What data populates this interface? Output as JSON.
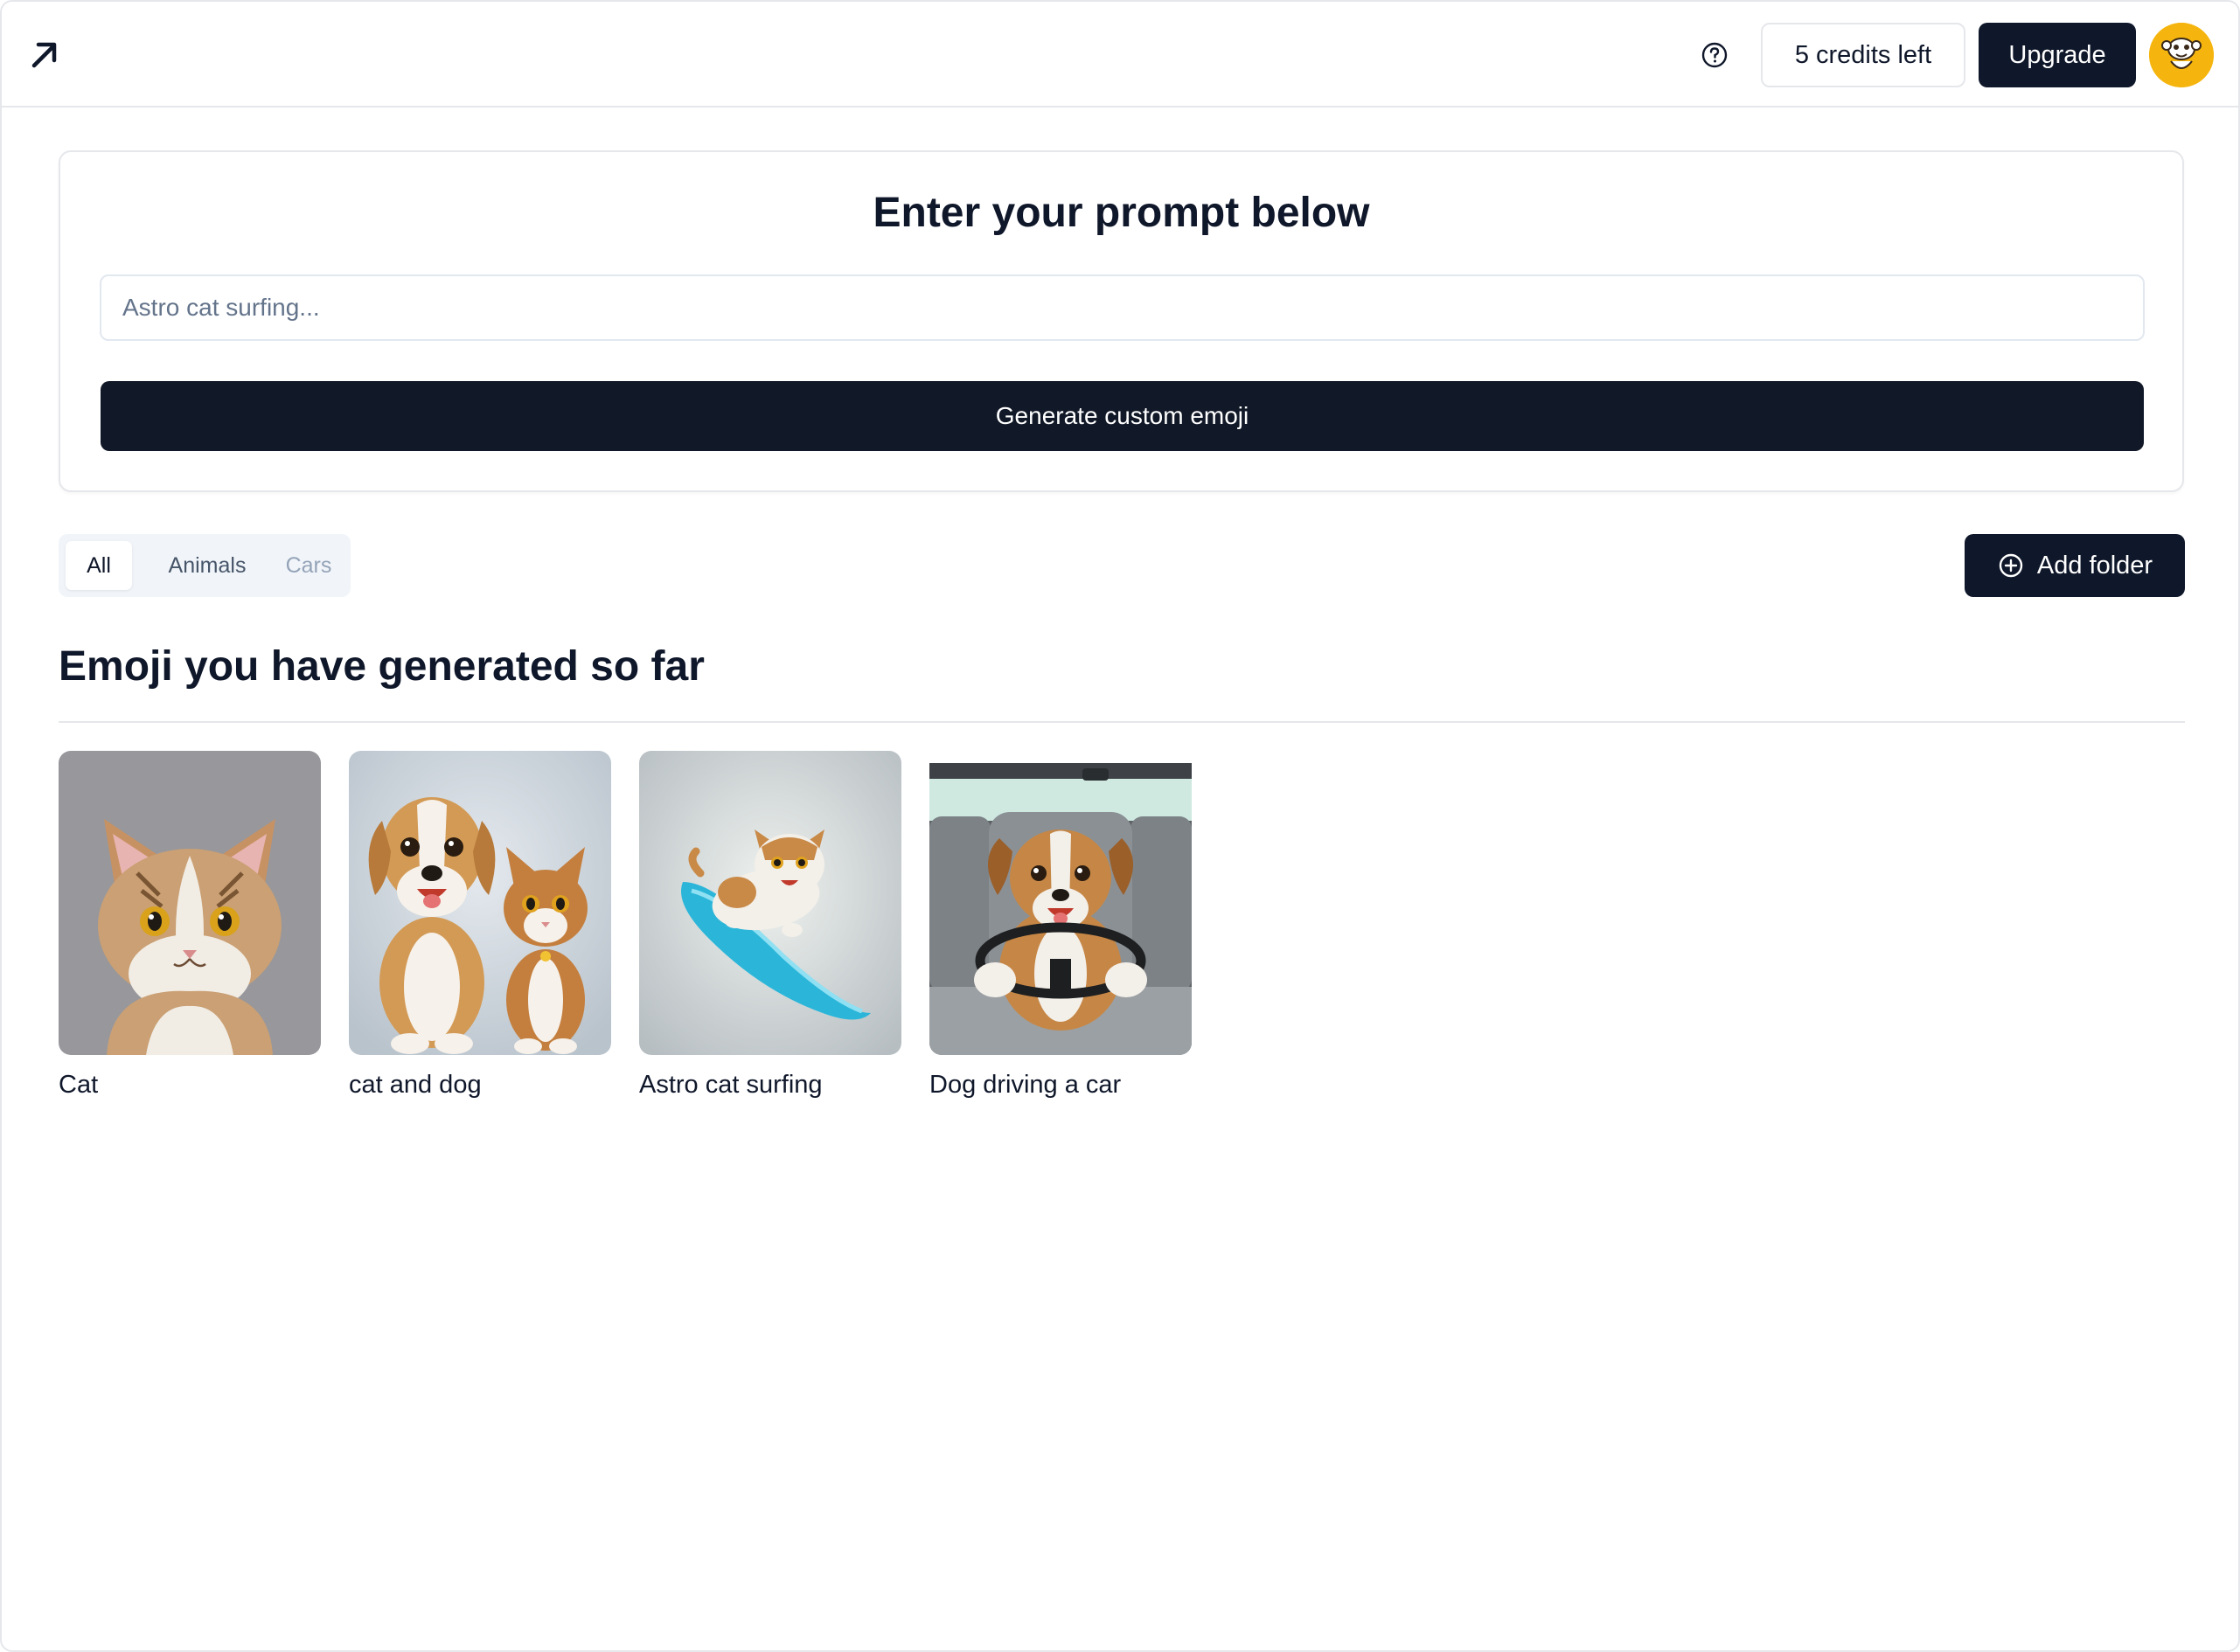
{
  "header": {
    "credits_label": "5 credits left",
    "upgrade_label": "Upgrade",
    "logo_icon": "arrow-up-right-icon",
    "help_icon": "help-circle-icon",
    "avatar_icon": "monkey-avatar-icon"
  },
  "prompt": {
    "title": "Enter your prompt below",
    "placeholder": "Astro cat surfing...",
    "value": "",
    "generate_label": "Generate custom emoji"
  },
  "tabs": [
    {
      "label": "All",
      "active": true
    },
    {
      "label": "Animals",
      "active": false
    },
    {
      "label": "Cars",
      "active": false
    }
  ],
  "add_folder_label": "Add folder",
  "gallery": {
    "title": "Emoji you have generated so far",
    "items": [
      {
        "caption": "Cat",
        "icon": "cat-emoji-image"
      },
      {
        "caption": "cat and dog",
        "icon": "cat-and-dog-emoji-image"
      },
      {
        "caption": "Astro cat surfing",
        "icon": "cat-surfing-emoji-image"
      },
      {
        "caption": "Dog driving a car",
        "icon": "dog-driving-emoji-image"
      }
    ]
  },
  "colors": {
    "primary": "#0f172a",
    "border": "#e5e7eb",
    "avatar_bg": "#f5b50e"
  }
}
